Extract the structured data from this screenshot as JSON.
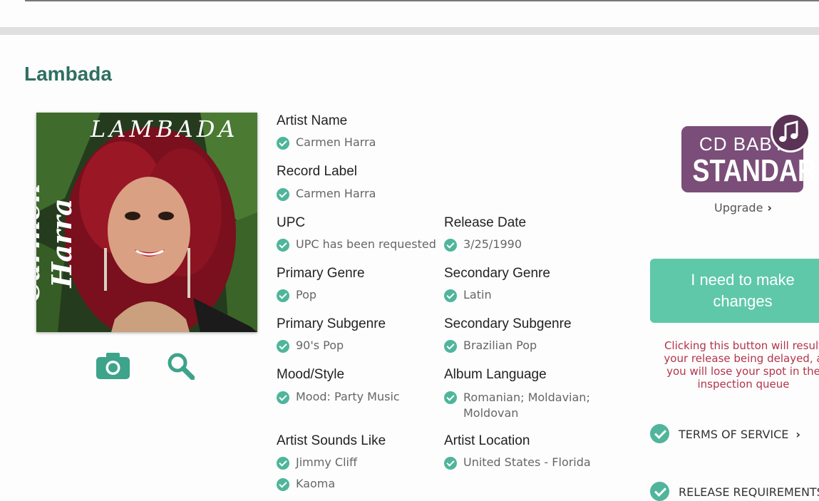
{
  "release": {
    "title": "Lambada",
    "cover": {
      "title_text": "LAMBADA",
      "artist_text": "Carmen Harra"
    }
  },
  "details": {
    "artist_name": {
      "label": "Artist Name",
      "value": "Carmen Harra"
    },
    "record_label": {
      "label": "Record Label",
      "value": "Carmen Harra"
    },
    "upc": {
      "label": "UPC",
      "value": "UPC has been requested"
    },
    "release_date": {
      "label": "Release Date",
      "value": "3/25/1990"
    },
    "primary_genre": {
      "label": "Primary Genre",
      "value": "Pop"
    },
    "secondary_genre": {
      "label": "Secondary Genre",
      "value": "Latin"
    },
    "primary_subgenre": {
      "label": "Primary Subgenre",
      "value": "90's Pop"
    },
    "secondary_subgenre": {
      "label": "Secondary Subgenre",
      "value": "Brazilian Pop"
    },
    "mood_style": {
      "label": "Mood/Style",
      "value": "Mood: Party Music"
    },
    "album_language": {
      "label": "Album Language",
      "value_line1": "Romanian; Moldavian;",
      "value_line2": "Moldovan"
    },
    "artist_sounds_like": {
      "label": "Artist Sounds Like",
      "values": [
        "Jimmy Cliff",
        "Kaoma"
      ]
    },
    "artist_location": {
      "label": "Artist Location",
      "value": "United States - Florida"
    }
  },
  "sidebar": {
    "badge_line1": "CD BABY",
    "badge_line2": "STANDARD",
    "upgrade_label": "Upgrade",
    "change_button_line1": "I need to make",
    "change_button_line2": "changes",
    "warning_lines": [
      "Clicking this button will result",
      "your release being delayed, a",
      "you will lose your spot in the",
      "inspection queue"
    ],
    "terms_label": "TERMS OF SERVICE",
    "requirements_label": "RELEASE REQUIREMENTS"
  },
  "colors": {
    "accent": "#2f6f62",
    "check": "#4fb59b",
    "button": "#5fc8a8",
    "badge": "#7a4e78",
    "warning": "#b2344a"
  }
}
